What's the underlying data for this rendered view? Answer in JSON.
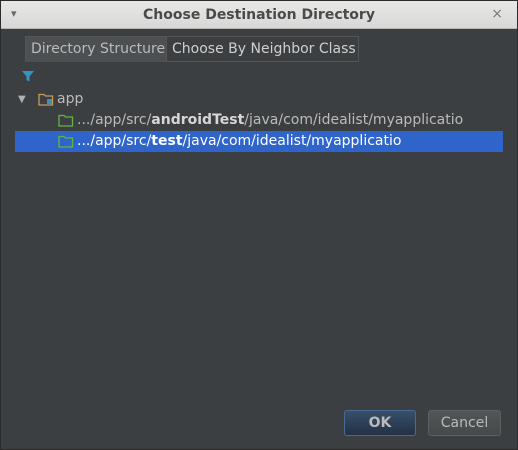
{
  "window": {
    "title": "Choose Destination Directory",
    "menu_glyph": "▾",
    "close_glyph": "×"
  },
  "tabs": [
    {
      "label": "Directory Structure",
      "selected": true
    },
    {
      "label": "Choose By Neighbor Class",
      "selected": false
    }
  ],
  "toolbar": {
    "filter_icon": "filter-icon"
  },
  "tree": {
    "root": {
      "label": "app",
      "expanded": true,
      "arrow": "▼"
    },
    "children": [
      {
        "prefix": ".../app/src/",
        "bold": "androidTest",
        "suffix": "/java/com/idealist/myapplicatio",
        "selected": false
      },
      {
        "prefix": ".../app/src/",
        "bold": "test",
        "suffix": "/java/com/idealist/myapplicatio",
        "selected": true
      }
    ]
  },
  "buttons": {
    "ok_label": "OK",
    "cancel_label": "Cancel"
  },
  "colors": {
    "background": "#3c3f41",
    "selection": "#2f65ca",
    "folder_green": "#62b543",
    "filter_blue": "#3592c4"
  }
}
